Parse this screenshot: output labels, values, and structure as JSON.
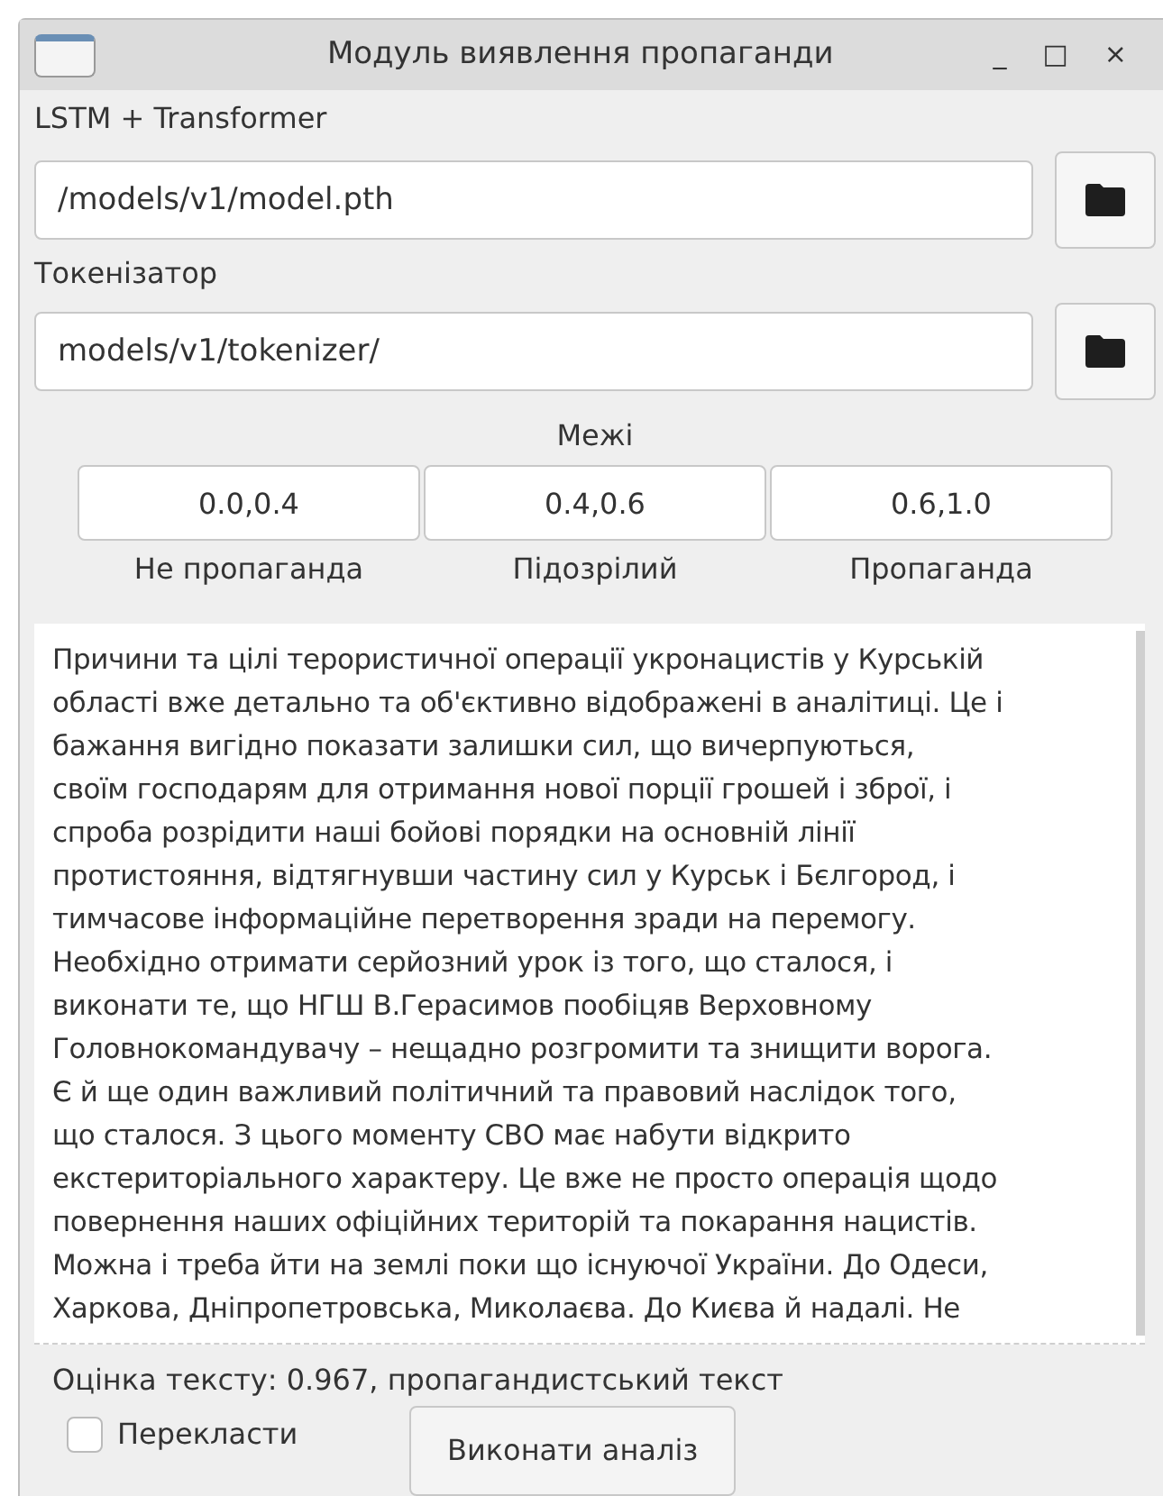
{
  "window": {
    "title": "Модуль виявлення пропаганди",
    "controls": [
      "_",
      "□",
      "×"
    ]
  },
  "model": {
    "label": "LSTM + Transformer",
    "value": "/models/v1/model.pth"
  },
  "tokenizer": {
    "label": "Токенізатор",
    "value": "models/v1/tokenizer/"
  },
  "thresholds": {
    "title": "Межі",
    "items": [
      {
        "value": "0.0,0.4",
        "label": "Не пропаганда"
      },
      {
        "value": "0.4,0.6",
        "label": "Підозрілий"
      },
      {
        "value": "0.6,1.0",
        "label": "Пропаганда"
      }
    ]
  },
  "text_area": {
    "lines": [
      "Причини та цілі терористичної операції укронацистів у Курській",
      "області вже детально та об'єктивно відображені в аналітиці. Це і",
      "бажання вигідно показати залишки сил, що вичерпуються,",
      "своїм господарям для отримання нової порції грошей і зброї, і",
      "спроба розрідити наші бойові порядки на основній лінії",
      "протистояння, відтягнувши частину сил у Курськ і Бєлгород, і",
      "тимчасове інформаційне перетворення зради на перемогу.",
      "Необхідно отримати серйозний урок із того, що сталося, і",
      "виконати те, що НГШ В.Герасимов пообіцяв Верховному",
      "Головнокомандувачу – нещадно розгромити та знищити ворога.",
      "Є й ще один важливий політичний та правовий наслідок того,",
      "що сталося. З цього моменту СВО має набути відкрито",
      "екстериторіального характеру. Це вже не просто операція щодо",
      "повернення наших офіційних територій та покарання нацистів.",
      "Можна і треба йти на землі поки що існуючої України. До Одеси,",
      "Харкова, Дніпропетровська, Миколаєва. До Києва й надалі. Не"
    ]
  },
  "result": "Оцінка тексту: 0.967, пропагандистський текст",
  "translate": {
    "label": "Перекласти",
    "checked": false
  },
  "run_button": "Виконати аналіз"
}
